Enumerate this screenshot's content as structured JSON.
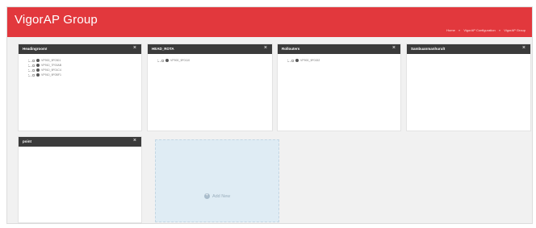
{
  "app": {
    "title": "VigorAP Group"
  },
  "breadcrumb": {
    "items": [
      "Home",
      "VigorAP Configuration",
      "VigorAP Group"
    ],
    "separator": "»"
  },
  "panels": [
    {
      "title": "Headingroom!",
      "close_icon": "×",
      "devices": [
        "VP900_9F0301",
        "VP910_7F00AB",
        "VP910_9F01C4",
        "VP910_9F0BF1"
      ]
    },
    {
      "title": "HEAD_ROTA",
      "close_icon": "×",
      "devices": [
        "VP900_9F0110"
      ]
    },
    {
      "title": "Rollouters",
      "close_icon": "×",
      "devices": [
        "VP900_9F0152"
      ]
    },
    {
      "title": "Sambuanmanhurult",
      "close_icon": "×",
      "devices": []
    },
    {
      "title": "point",
      "close_icon": "×",
      "devices": []
    }
  ],
  "add_new": {
    "label": "Add New",
    "icon": "plus-circle-icon"
  },
  "colors": {
    "header_bg": "#e2383d",
    "panel_header_bg": "#3b3b3b",
    "add_new_bg": "#dfecf4"
  }
}
